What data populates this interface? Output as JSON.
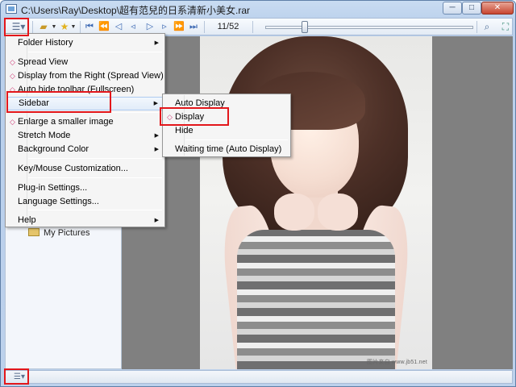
{
  "window": {
    "title": "C:\\Users\\Ray\\Desktop\\超有范兒的日系清新小美女.rar",
    "minimize": "─",
    "maximize": "□",
    "close": "✕"
  },
  "toolbar": {
    "menu_icon": "menu-icon",
    "open_icon": "folder-open-icon",
    "favorites_icon": "star-icon",
    "page_counter": "11/52",
    "slider_position": 0.19,
    "nav_icons": [
      "first-page-icon",
      "previous-folder-icon",
      "previous-page-icon",
      "previous-single-icon",
      "next-single-icon",
      "next-page-icon",
      "next-folder-icon",
      "last-page-icon"
    ],
    "nav_glyphs": [
      "⏮",
      "⏪",
      "◁",
      "◃",
      "▷",
      "▹",
      "⏩",
      "⏭"
    ],
    "search_icon": "search-icon",
    "fullscreen_icon": "fullscreen-icon"
  },
  "main_menu": {
    "items": [
      {
        "label": "Folder History",
        "submenu": true
      },
      {
        "label": "Spread View",
        "checked": true
      },
      {
        "label": "Display from the Right (Spread View)",
        "checked": true
      },
      {
        "label": "Auto hide toolbar (Fullscreen)",
        "checked": true
      },
      {
        "label": "Sidebar",
        "submenu": true,
        "highlighted": true
      },
      {
        "label": "Enlarge a smaller image",
        "checked": true
      },
      {
        "label": "Stretch Mode",
        "submenu": true
      },
      {
        "label": "Background Color",
        "submenu": true
      },
      {
        "label": "Key/Mouse Customization..."
      },
      {
        "label": "Plug-in Settings..."
      },
      {
        "label": "Language Settings..."
      },
      {
        "label": "Help",
        "submenu": true
      }
    ]
  },
  "sidebar_submenu": {
    "items": [
      {
        "label": "Auto Display"
      },
      {
        "label": "Display",
        "checked": true
      },
      {
        "label": "Hide"
      },
      {
        "label": "Waiting time (Auto Display)"
      }
    ]
  },
  "sidebar": {
    "folder_label": "My Pictures"
  },
  "photo": {
    "watermark": "图片来自 www.jb51.net"
  },
  "colors": {
    "accent_red": "#e3171b",
    "check_mark": "#d0407a",
    "viewer_bg": "#808080"
  }
}
